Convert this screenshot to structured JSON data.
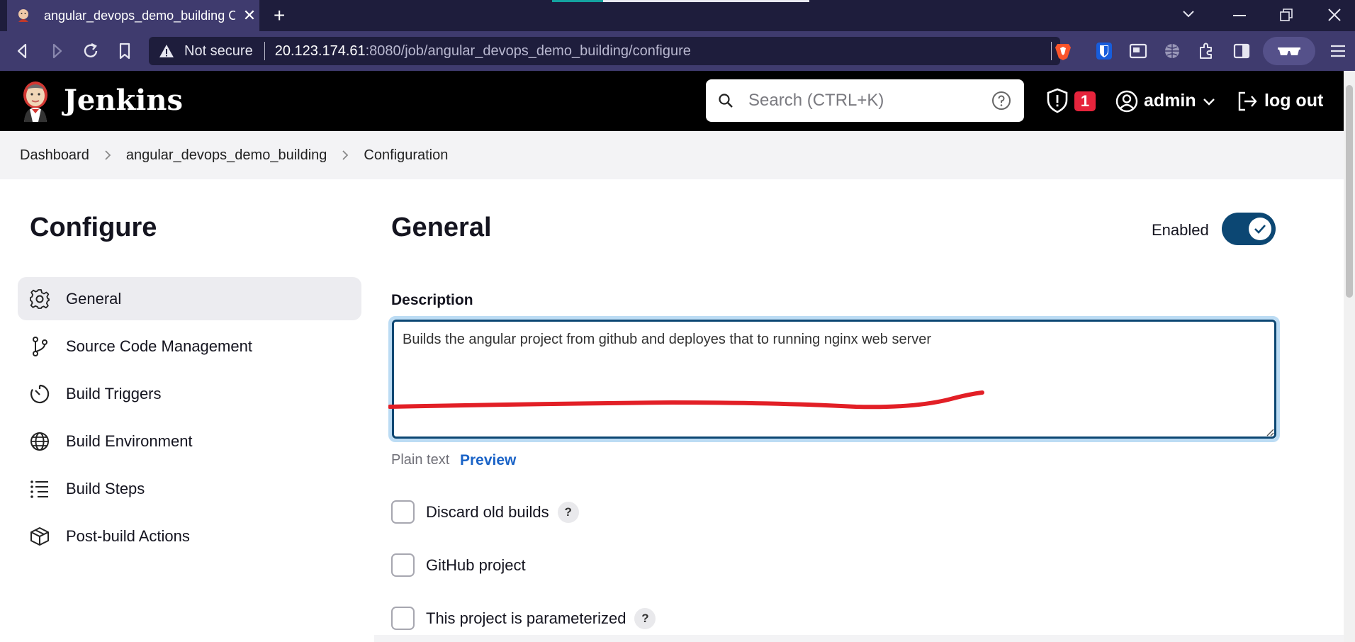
{
  "browser": {
    "tab_title": "angular_devops_demo_building Config",
    "close_glyph": "✕",
    "newtab_glyph": "+",
    "security_label": "Not secure",
    "url_host": "20.123.174.61",
    "url_path": ":8080/job/angular_devops_demo_building/configure",
    "icons": [
      "back-icon",
      "forward-icon",
      "reload-icon",
      "bookmark-icon",
      "brave-shield-icon",
      "bitwarden-icon",
      "picture-in-picture-icon",
      "vpn-globe-icon",
      "extensions-icon",
      "sidebar-icon",
      "profile-icon",
      "menu-icon"
    ]
  },
  "header": {
    "brand": "Jenkins",
    "search_placeholder": "Search (CTRL+K)",
    "security_count": "1",
    "user": "admin",
    "logout": "log out"
  },
  "breadcrumb": {
    "items": [
      "Dashboard",
      "angular_devops_demo_building",
      "Configuration"
    ]
  },
  "sidebar": {
    "title": "Configure",
    "items": [
      {
        "label": "General",
        "icon": "gear-icon",
        "active": true
      },
      {
        "label": "Source Code Management",
        "icon": "git-branch-icon"
      },
      {
        "label": "Build Triggers",
        "icon": "timer-icon"
      },
      {
        "label": "Build Environment",
        "icon": "globe-icon"
      },
      {
        "label": "Build Steps",
        "icon": "list-icon"
      },
      {
        "label": "Post-build Actions",
        "icon": "package-icon"
      }
    ]
  },
  "main": {
    "section_title": "General",
    "enabled_label": "Enabled",
    "enabled": true,
    "description_label": "Description",
    "description_value": "Builds the angular project from github and deployes that to running nginx web server",
    "plain_text_label": "Plain text",
    "preview_label": "Preview",
    "options": [
      {
        "label": "Discard old builds",
        "help": "?",
        "checked": false
      },
      {
        "label": "GitHub project",
        "checked": false
      },
      {
        "label": "This project is parameterized",
        "help": "?",
        "checked": false
      }
    ]
  },
  "colors": {
    "browser_frame": "#1e1d3c",
    "browser_toolbar": "#3f3b6e",
    "jenkins_header": "#000000",
    "accent_navy": "#0c4773",
    "link_blue": "#1a63c7",
    "badge_red": "#e6243c",
    "annotation_red": "#e21f26"
  }
}
